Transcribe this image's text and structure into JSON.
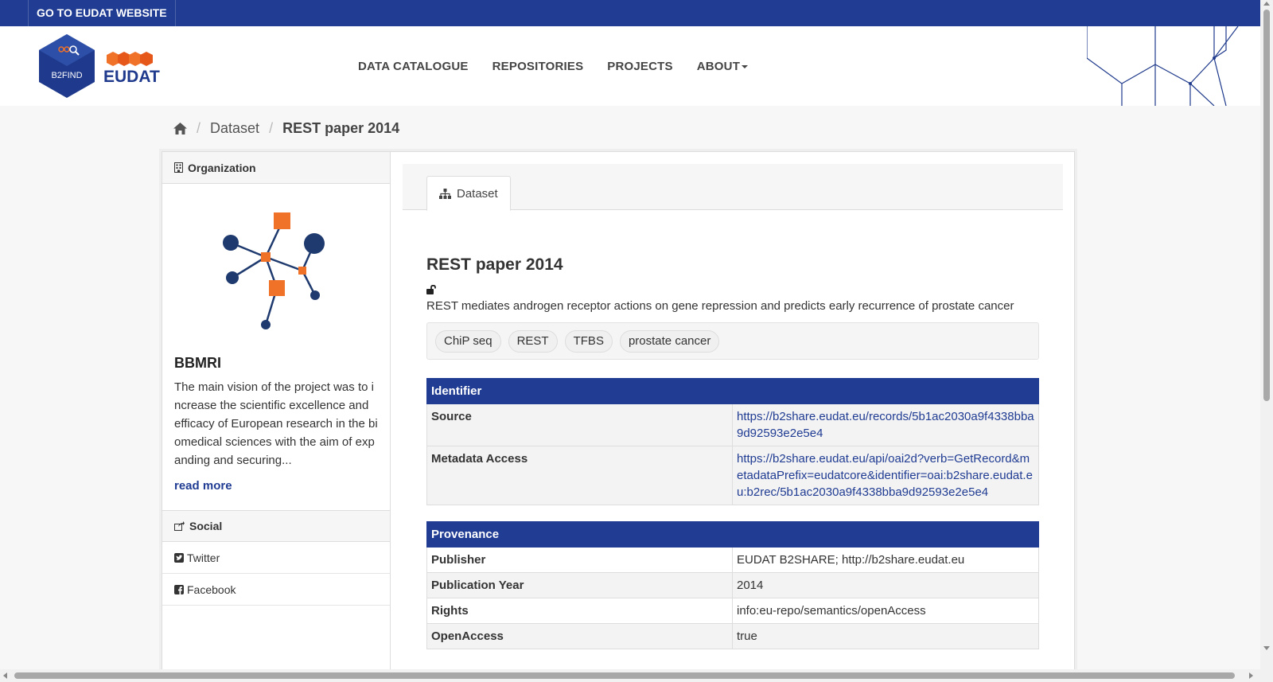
{
  "topbar": {
    "link_label": "GO TO EUDAT WEBSITE"
  },
  "header": {
    "logo_b2find": "B2FIND",
    "logo_eudat": "EUDAT",
    "nav": [
      "DATA CATALOGUE",
      "REPOSITORIES",
      "PROJECTS",
      "ABOUT"
    ]
  },
  "breadcrumb": {
    "items": [
      "Dataset",
      "REST paper 2014"
    ]
  },
  "sidebar": {
    "organization_heading": "Organization",
    "org_name": "BBMRI",
    "org_description": "The main vision of the project was to increase the scientific excellence and efficacy of European research in the biomedical sciences with the aim of expanding and securing...",
    "read_more": "read more",
    "social_heading": "Social",
    "social_items": [
      "Twitter",
      "Facebook"
    ]
  },
  "main": {
    "tab_label": "Dataset",
    "title": "REST paper 2014",
    "notes": "REST mediates androgen receptor actions on gene repression and predicts early recurrence of prostate cancer",
    "tags": [
      "ChiP seq",
      "REST",
      "TFBS",
      "prostate cancer"
    ],
    "identifier": {
      "heading": "Identifier",
      "rows": [
        {
          "label": "Source",
          "value": "https://b2share.eudat.eu/records/5b1ac2030a9f4338bba9d92593e2e5e4"
        },
        {
          "label": "Metadata Access",
          "value": "https://b2share.eudat.eu/api/oai2d?verb=GetRecord&metadataPrefix=eudatcore&identifier=oai:b2share.eudat.eu:b2rec/5b1ac2030a9f4338bba9d92593e2e5e4"
        }
      ]
    },
    "provenance": {
      "heading": "Provenance",
      "rows": [
        {
          "label": "Publisher",
          "value": "EUDAT B2SHARE; http://b2share.eudat.eu"
        },
        {
          "label": "Publication Year",
          "value": "2014"
        },
        {
          "label": "Rights",
          "value": "info:eu-repo/semantics/openAccess"
        },
        {
          "label": "OpenAccess",
          "value": "true"
        }
      ]
    }
  },
  "colors": {
    "brand_blue": "#203c93",
    "accent_orange": "#f07128",
    "node_navy": "#1f3a6e"
  }
}
